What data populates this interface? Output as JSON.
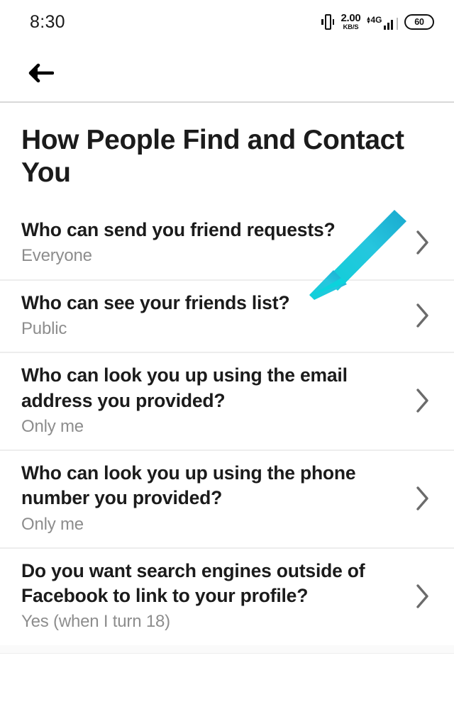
{
  "status_bar": {
    "time": "8:30",
    "vibrate_icon": "vibrate-icon",
    "network_speed_value": "2.00",
    "network_speed_unit": "KB/S",
    "network_generation": "4G",
    "signal_icon": "signal-bars-icon",
    "battery_level": "60"
  },
  "nav": {
    "back_icon": "back-arrow-icon"
  },
  "page": {
    "title": "How People Find and Contact You"
  },
  "settings": {
    "chevron_icon": "chevron-right-icon",
    "rows": [
      {
        "title": "Who can send you friend requests?",
        "value": "Everyone"
      },
      {
        "title": "Who can see your friends list?",
        "value": "Public"
      },
      {
        "title": "Who can look you up using the email address you provided?",
        "value": "Only me"
      },
      {
        "title": "Who can look you up using the phone number you provided?",
        "value": "Only me"
      },
      {
        "title": "Do you want search engines outside of Facebook to link to your profile?",
        "value": "Yes (when I turn 18)"
      }
    ]
  },
  "annotation": {
    "type": "arrow",
    "color": "#1fbcd8",
    "points_to": "Who can see your friends list?"
  },
  "colors": {
    "background": "#ffffff",
    "primary_text": "#1b1b1b",
    "secondary_text": "#8d8d8d",
    "divider": "#ededed",
    "chevron": "#6b6b6b",
    "annotation_cyan": "#1fbcd8"
  }
}
